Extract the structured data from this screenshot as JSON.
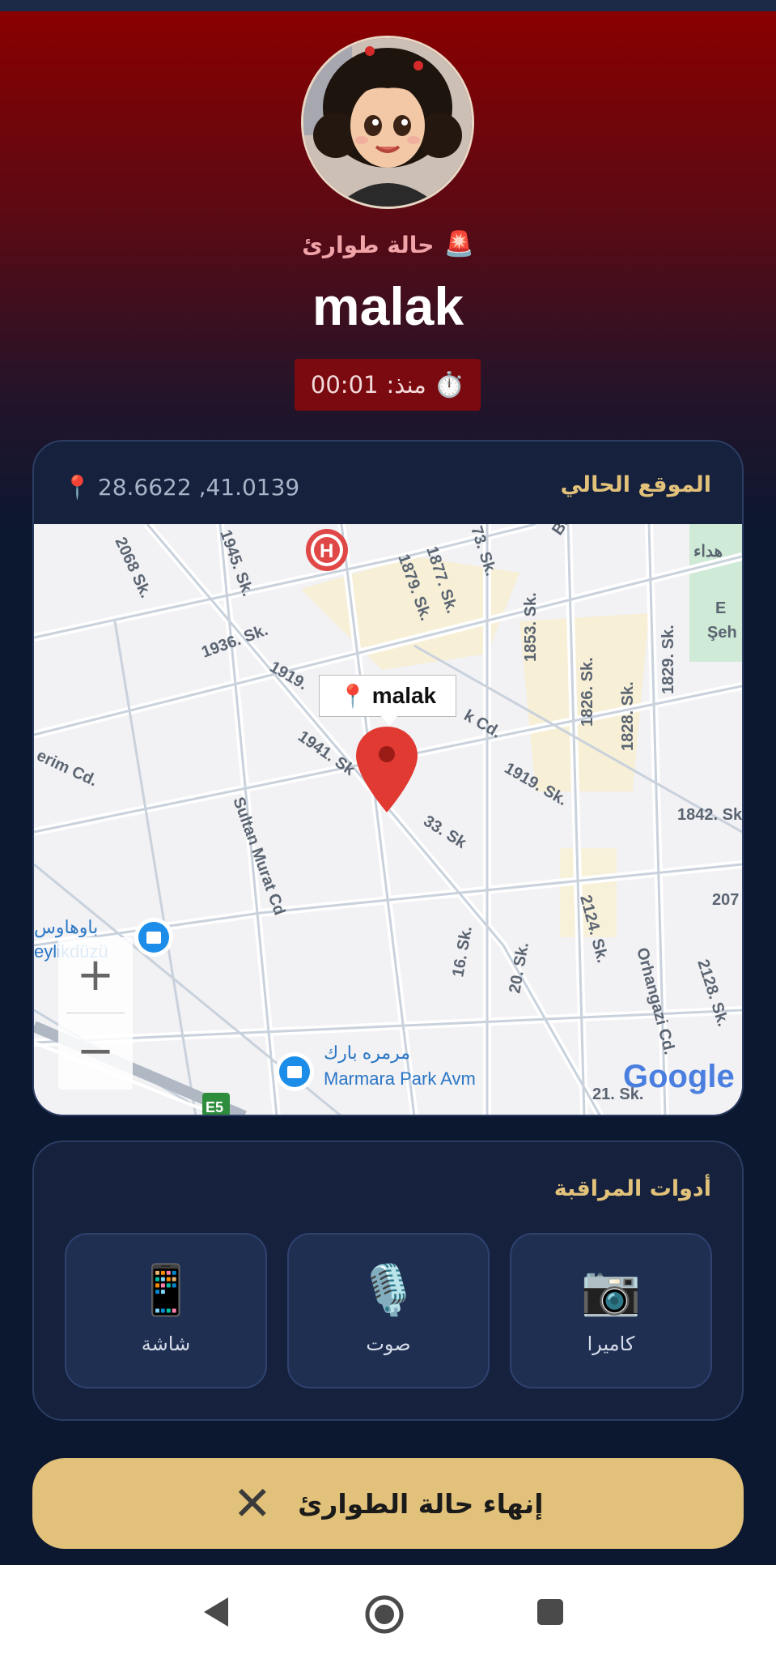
{
  "header": {
    "emergency_label": "حالة طوارئ",
    "emergency_icon": "🚨",
    "user_name": "malak",
    "timer_label": "منذ:",
    "timer_value": "00:01",
    "timer_icon": "⏱️"
  },
  "location": {
    "title": "الموقع الحالي",
    "coordinates": "28.6622 ,41.0139",
    "pin_icon": "📍",
    "map_marker_label": "malak",
    "map_labels": {
      "s2068": "2068 Sk.",
      "s1945": "1945. Sk.",
      "s1879": "1879. Sk.",
      "s1877": "1877. Sk.",
      "s73": "73. Sk.",
      "s1936": "1936. Sk.",
      "s1919a": "1919.",
      "s1941": "1941. Sk",
      "s1853": "1853. Sk.",
      "s1826": "1826. Sk.",
      "s1828": "1828. Sk.",
      "s1829": "1829. Sk.",
      "s1919b": "1919. Sk.",
      "s1842": "1842. Sk.",
      "erim": "erim Cd.",
      "sultan": "Sultan Murat Cd",
      "s33": "33. Sk",
      "kcd": "k Cd.",
      "s16": "16. Sk.",
      "s20": "20. Sk.",
      "s2124": "2124. Sk.",
      "orhangazi": "Orhangazi Cd.",
      "s2128": "2128. Sk.",
      "s207": "207",
      "s21": "21. Sk.",
      "bauhaus_ar": "باوهاوس",
      "bauhaus_latin": "eylikdüzü",
      "marmara_ar": "مرمره بارك",
      "marmara": "Marmara Park Avm",
      "e5": "E5",
      "sehit": "Şeh",
      "e_label": "E",
      "park_ar": "هداء",
      "bo": "Bo"
    },
    "zoom_in": "+",
    "zoom_out": "−",
    "google_logo": "Google"
  },
  "tools": {
    "title": "أدوات المراقبة",
    "items": [
      {
        "label": "كاميرا",
        "icon": "📷"
      },
      {
        "label": "صوت",
        "icon": "🎙️"
      },
      {
        "label": "شاشة",
        "icon": "📱"
      }
    ]
  },
  "actions": {
    "end_label": "إنهاء حالة الطوارئ",
    "end_icon": "✕"
  },
  "colors": {
    "accent_gold": "#e2c27a",
    "emergency_red": "#8a0000",
    "card_bg": "#15213d",
    "page_bg": "#0c1730"
  }
}
